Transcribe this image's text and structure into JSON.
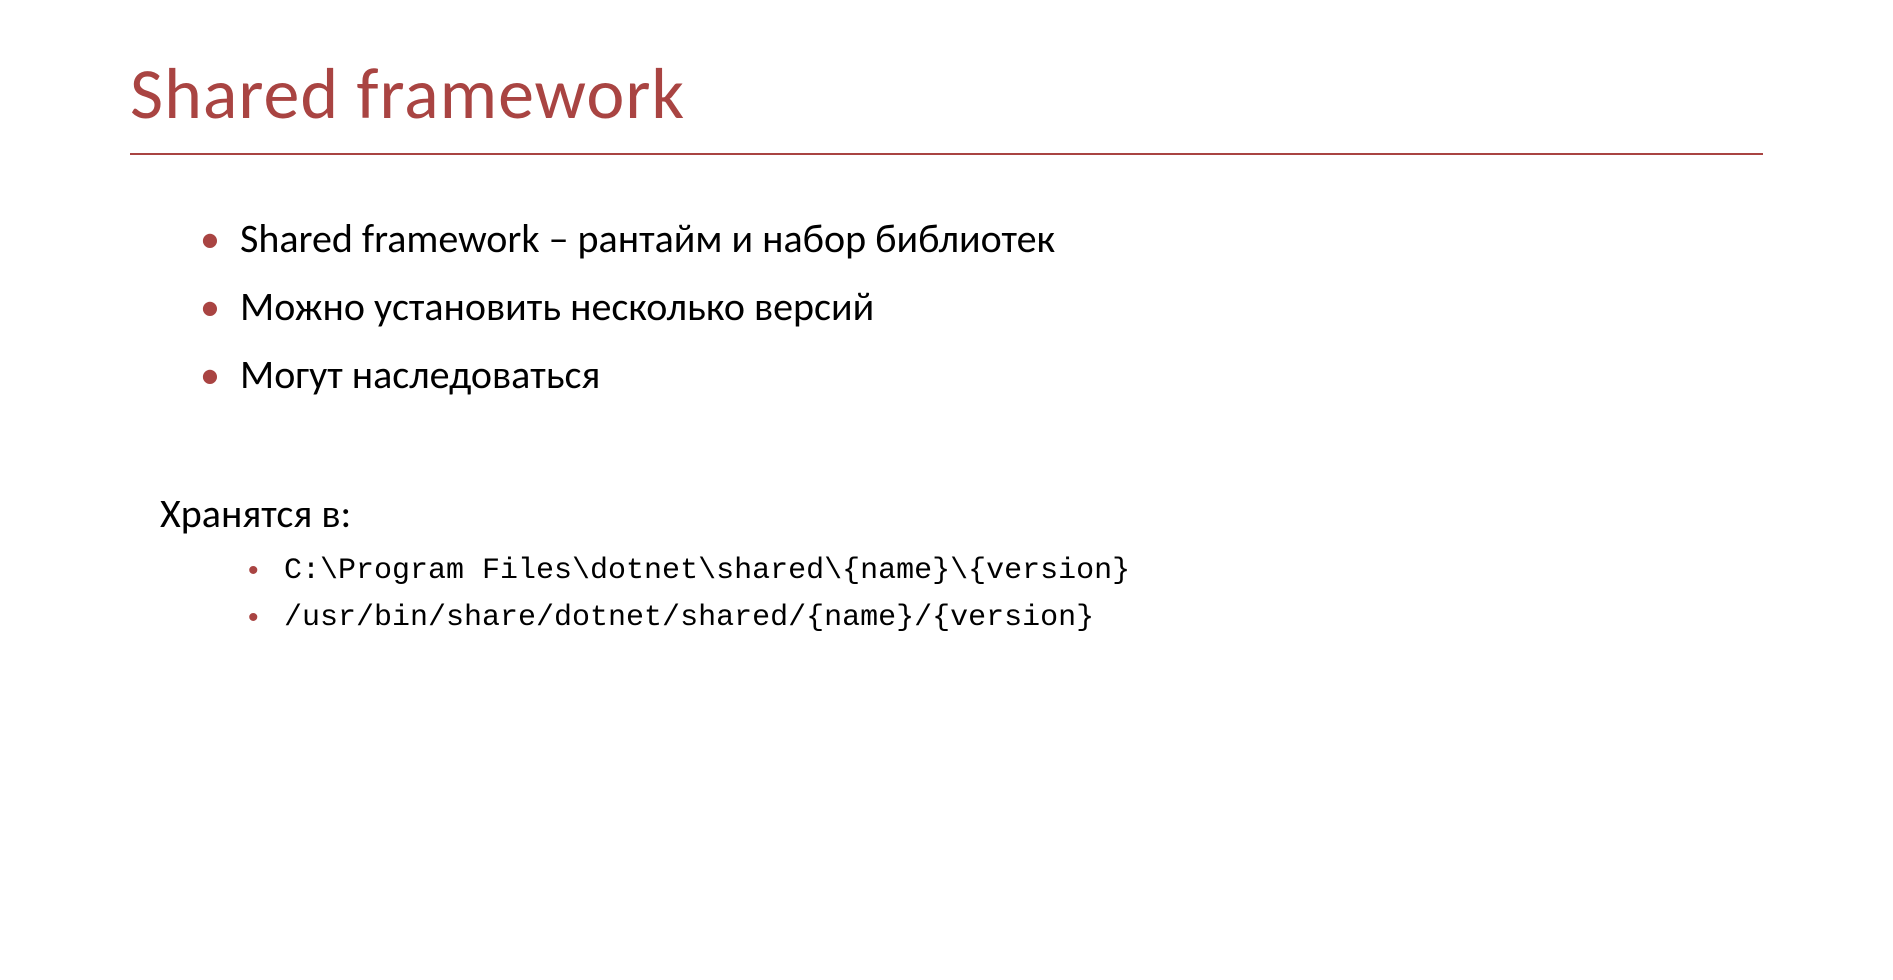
{
  "slide": {
    "title": "Shared framework",
    "bullets": [
      "Shared framework – рантайм и набор библиотек",
      "Можно установить несколько версий",
      "Могут наследоваться"
    ],
    "subheading": "Хранятся в:",
    "sub_bullets": [
      "C:\\Program Files\\dotnet\\shared\\{name}\\{version}",
      "/usr/bin/share/dotnet/shared/{name}/{version}"
    ]
  }
}
